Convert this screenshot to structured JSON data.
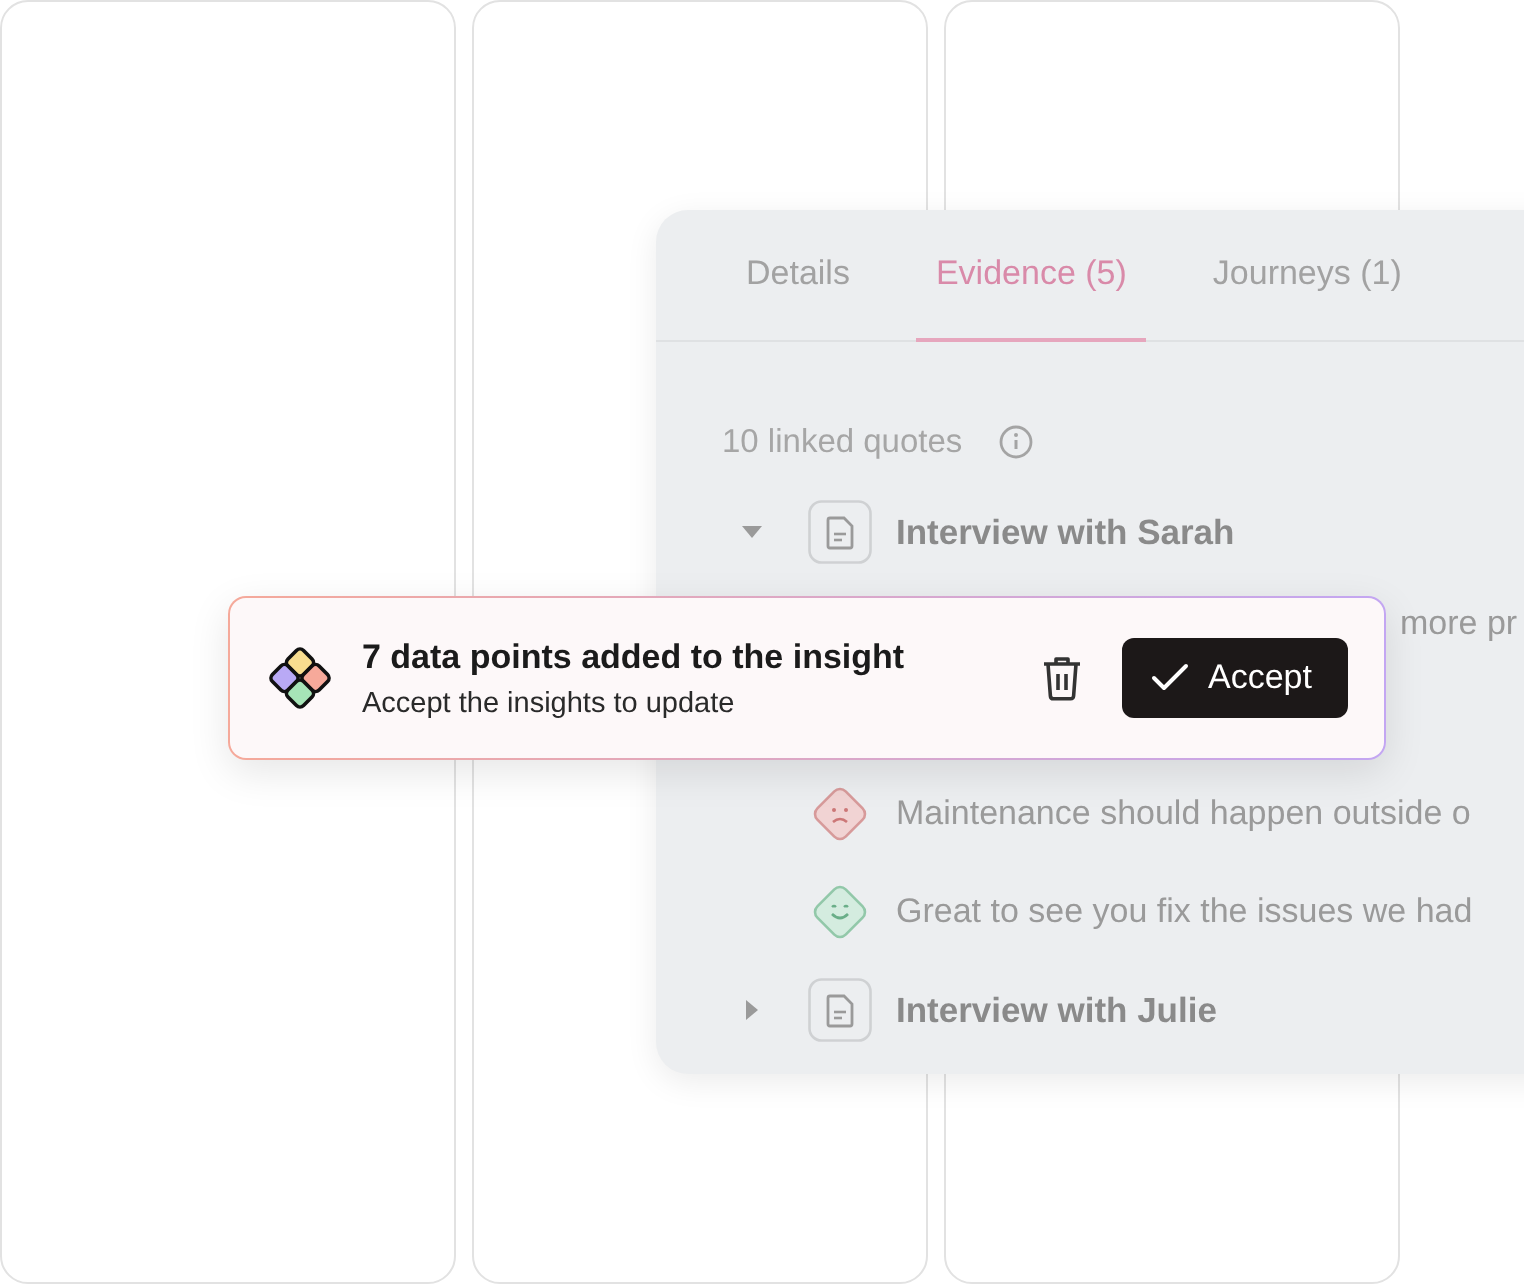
{
  "columns": [
    {
      "kind": "empty"
    },
    {
      "kind": "empty"
    },
    {
      "kind": "empty"
    }
  ],
  "panel": {
    "tabs": [
      {
        "label": "Details",
        "selected": false
      },
      {
        "label": "Evidence (5)",
        "selected": true
      },
      {
        "label": "Journeys (1)",
        "selected": false
      }
    ],
    "summary": "10 linked quotes",
    "interviews": [
      {
        "title": "Interview with Sarah",
        "expanded": true,
        "quotes": [
          {
            "text": "more pr",
            "kind": "covered"
          },
          {
            "text": "Maintenance should happen outside o",
            "kind": "negative"
          },
          {
            "text": "Great to see you fix the issues we had",
            "kind": "positive"
          }
        ]
      },
      {
        "title": "Interview with Julie",
        "expanded": false
      }
    ]
  },
  "toast": {
    "title": "7 data points added to the insight",
    "subtitle": "Accept the insights to update",
    "button": "Accept"
  }
}
